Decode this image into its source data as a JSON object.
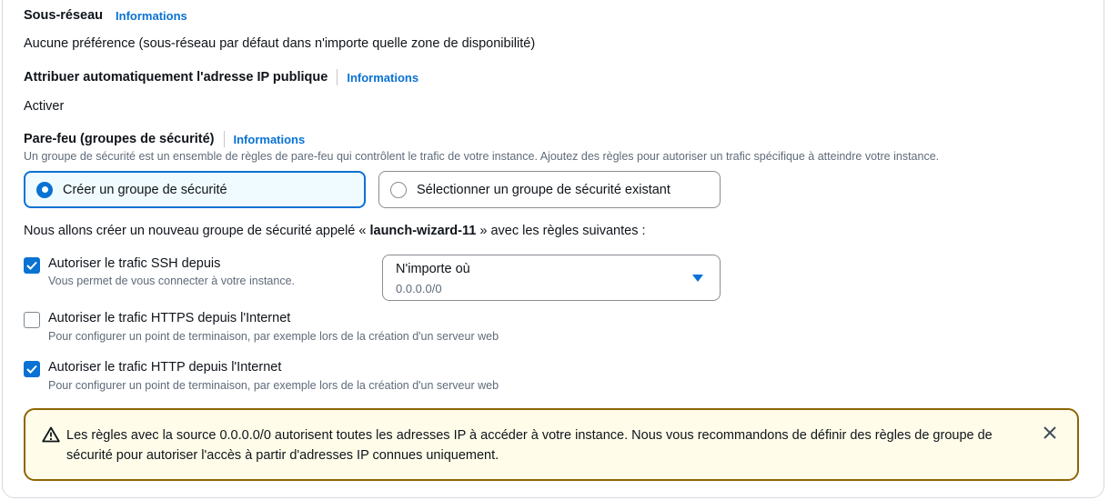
{
  "subnet": {
    "label": "Sous-réseau",
    "info": "Informations",
    "value": "Aucune préférence (sous-réseau par défaut dans n'importe quelle zone de disponibilité)"
  },
  "public_ip": {
    "label": "Attribuer automatiquement l'adresse IP publique",
    "info": "Informations",
    "value": "Activer"
  },
  "firewall": {
    "label": "Pare-feu (groupes de sécurité)",
    "info": "Informations",
    "description": "Un groupe de sécurité est un ensemble de règles de pare-feu qui contrôlent le trafic de votre instance. Ajoutez des règles pour autoriser un trafic spécifique à atteindre votre instance.",
    "options": [
      {
        "label": "Créer un groupe de sécurité",
        "selected": true
      },
      {
        "label": "Sélectionner un groupe de sécurité existant",
        "selected": false
      }
    ],
    "create_text_before": "Nous allons créer un nouveau groupe de sécurité appelé « ",
    "group_name": "launch-wizard-11",
    "create_text_after": " » avec les règles suivantes :"
  },
  "rules": [
    {
      "label": "Autoriser le trafic SSH depuis",
      "description": "Vous permet de vous connecter à votre instance.",
      "checked": true
    },
    {
      "label": "Autoriser le trafic HTTPS depuis l'Internet",
      "description": "Pour configurer un point de terminaison, par exemple lors de la création d'un serveur web",
      "checked": false
    },
    {
      "label": "Autoriser le trafic HTTP depuis l'Internet",
      "description": "Pour configurer un point de terminaison, par exemple lors de la création d'un serveur web",
      "checked": true
    }
  ],
  "ssh_source": {
    "value": "N'importe où",
    "sub": "0.0.0.0/0"
  },
  "alert": {
    "message": "Les règles avec la source 0.0.0.0/0 autorisent toutes les adresses IP à accéder à votre instance. Nous vous recommandons de définir des règles de groupe de sécurité pour autoriser l'accès à partir d'adresses IP connues uniquement.",
    "icon": "warning-icon"
  },
  "colors": {
    "accent": "#0972d3",
    "warning_border": "#8d6605",
    "warning_bg": "#fffce9",
    "text": "#0f141a",
    "secondary_text": "#5f6b7a"
  }
}
